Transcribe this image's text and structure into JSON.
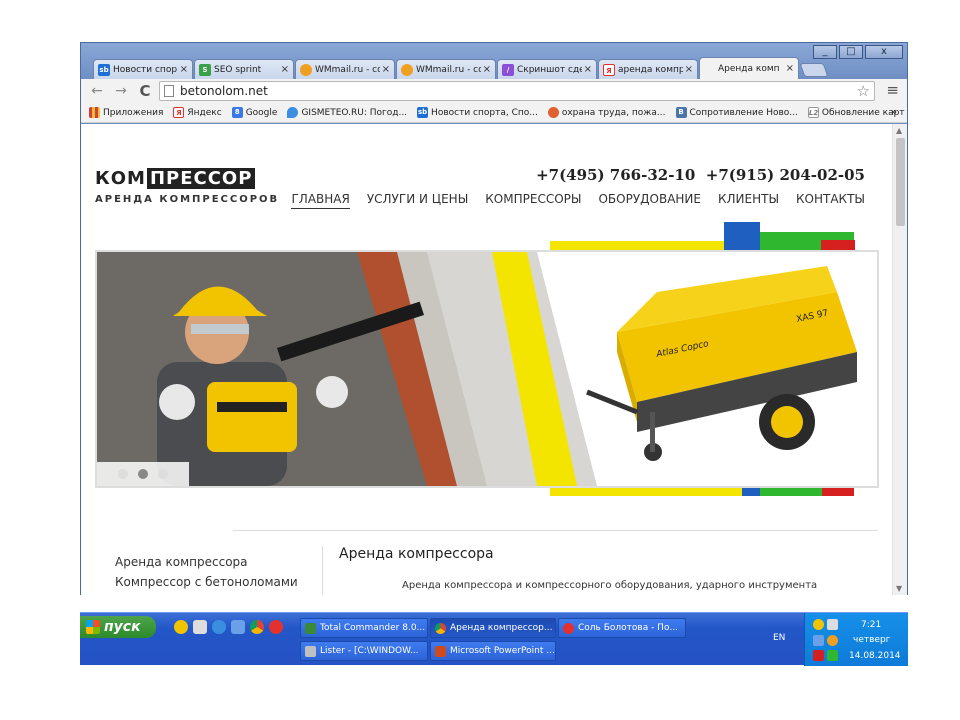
{
  "window": {
    "controls": [
      "_",
      "□",
      "x"
    ]
  },
  "tabs": [
    {
      "title": "Новости спор",
      "favicon": "sb-icon",
      "color": "#1e6fd6"
    },
    {
      "title": "SEO sprint",
      "favicon": "seo-icon",
      "color": "#3aa04a"
    },
    {
      "title": "WMmail.ru - со",
      "favicon": "wmmail-icon",
      "color": "#f0a020"
    },
    {
      "title": "WMmail.ru - со",
      "favicon": "wmmail-icon",
      "color": "#f0a020"
    },
    {
      "title": "Скриншот сде",
      "favicon": "pen-icon",
      "color": "#8a4fd6"
    },
    {
      "title": "аренда компр",
      "favicon": "yandex-icon",
      "color": "#e53030"
    },
    {
      "title": "Аренда комп",
      "favicon": "none",
      "color": "#f2f2f2",
      "active": true
    }
  ],
  "tab_close": "×",
  "toolbar": {
    "back": "←",
    "forward": "→",
    "reload": "C",
    "url": "betonolom.net",
    "star": "☆",
    "menu": "≡"
  },
  "bookmarks": [
    {
      "label": "Приложения",
      "icon": "apps-icon",
      "color": "#d04040"
    },
    {
      "label": "Яндекс",
      "icon": "yandex-icon",
      "color": "#e53030"
    },
    {
      "label": "Google",
      "icon": "google-icon",
      "color": "#3b78e7"
    },
    {
      "label": "GISMETEO.RU: Погод...",
      "icon": "gismeteo-icon",
      "color": "#3b8ee0"
    },
    {
      "label": "Новости спорта, Спо...",
      "icon": "sb-icon",
      "color": "#1e6fd6"
    },
    {
      "label": "охрана труда, пожа...",
      "icon": "circle-icon",
      "color": "#e06030"
    },
    {
      "label": "Сопротивление Ново...",
      "icon": "vk-icon",
      "color": "#4a76a8"
    },
    {
      "label": "Обновление карт дл...",
      "icon": "l2-icon",
      "color": "#999999"
    }
  ],
  "bookmarks_more": "»",
  "site": {
    "logo_part1": "КОМ",
    "logo_part2": "ПРЕССОР",
    "logo_sub": "АРЕНДА КОМПРЕССОРОВ",
    "phones": "+7(495) 766-32-10  +7(915) 204-02-05",
    "nav": [
      "ГЛАВНАЯ",
      "УСЛУГИ И ЦЕНЫ",
      "КОМПРЕССОРЫ",
      "ОБОРУДОВАНИЕ",
      "КЛИЕНТЫ",
      "КОНТАКТЫ"
    ],
    "banner": {
      "compressor_brand": "Atlas Copco",
      "compressor_model": "XAS 97",
      "slides": 3,
      "active_slide": 2
    },
    "side_menu": [
      "Аренда компрессора",
      "Компрессор с бетоноломами"
    ],
    "content_title": "Аренда компрессора",
    "content_text": "Аренда компрессора и компрессорного оборудования, ударного инструмента"
  },
  "taskbar": {
    "start_label": "пуск",
    "buttons": [
      {
        "label": "Total Commander 8.0...",
        "color": "#3a8a3a"
      },
      {
        "label": "Аренда компрессор...",
        "color": "#e8a020",
        "active": true
      },
      {
        "label": "Соль Болотова - По...",
        "color": "#e53030"
      },
      {
        "label": "Lister - [C:\\WINDOW...",
        "color": "#c0c0c0"
      },
      {
        "label": "Microsoft PowerPoint ...",
        "color": "#d04a20"
      }
    ],
    "lang": "EN",
    "time": "7:21",
    "day": "четверг",
    "date": "14.08.2014"
  },
  "colors": {
    "yellow": "#f4e500",
    "blue": "#1f5fc0",
    "green": "#2fb82f",
    "red": "#d62020"
  }
}
